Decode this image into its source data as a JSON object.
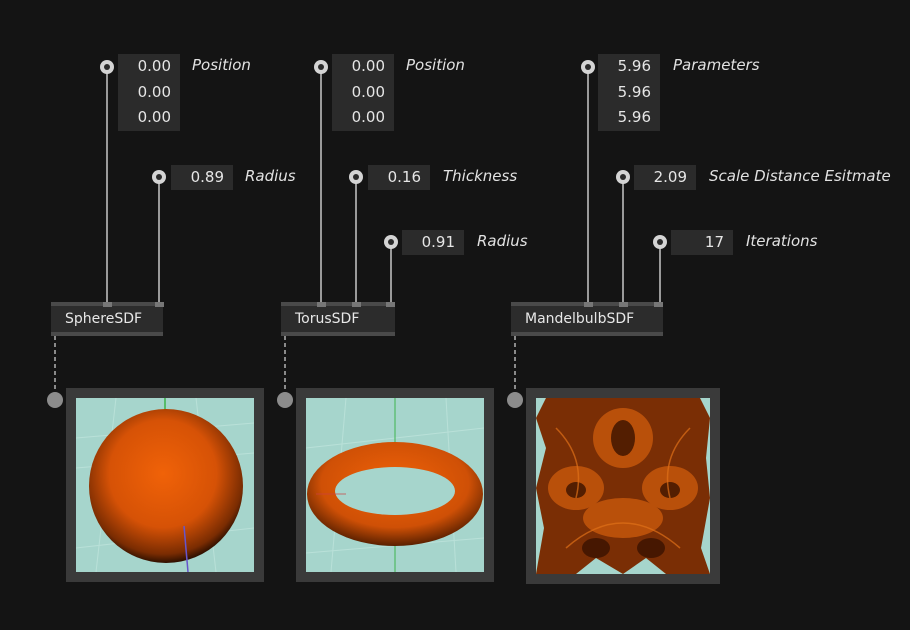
{
  "nodes": [
    {
      "name": "SphereSDF",
      "inputs": [
        {
          "label": "Position",
          "values": [
            "0.00",
            "0.00",
            "0.00"
          ]
        },
        {
          "label": "Radius",
          "values": [
            "0.89"
          ]
        }
      ]
    },
    {
      "name": "TorusSDF",
      "inputs": [
        {
          "label": "Position",
          "values": [
            "0.00",
            "0.00",
            "0.00"
          ]
        },
        {
          "label": "Thickness",
          "values": [
            "0.16"
          ]
        },
        {
          "label": "Radius",
          "values": [
            "0.91"
          ]
        }
      ]
    },
    {
      "name": "MandelbulbSDF",
      "inputs": [
        {
          "label": "Parameters",
          "values": [
            "5.96",
            "5.96",
            "5.96"
          ]
        },
        {
          "label": "Scale Distance Esitmate",
          "values": [
            "2.09"
          ]
        },
        {
          "label": "Iterations",
          "values": [
            "17"
          ]
        }
      ]
    }
  ],
  "colors": {
    "background": "#141414",
    "value_box": "#2b2b2b",
    "node_body": "#2c2c2c",
    "viewport_bg": "#a6d5cc",
    "shape_orange": "#e05a08"
  },
  "icons": {
    "pin": "input-pin-icon",
    "output": "output-pin-icon"
  }
}
